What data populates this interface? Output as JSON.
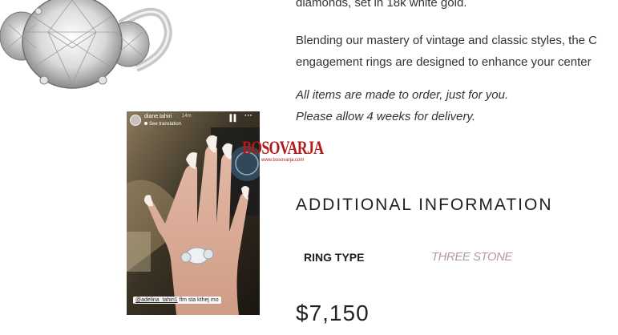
{
  "product": {
    "desc_top": "diamonds, set in 18k white gold.",
    "paragraph_lines": [
      "Blending our mastery of vintage and classic styles, the C",
      "engagement rings are designed to enhance your center"
    ],
    "made_to_order": "All items are made to order, just for you.",
    "delivery_note": "Please allow 4 weeks for delivery.",
    "additional_info_heading": "ADDITIONAL INFORMATION",
    "spec": {
      "label": "RING TYPE",
      "value": "THREE STONE"
    },
    "price": "$7,150"
  },
  "story": {
    "username": "diane.tahiri",
    "time": "14m",
    "translation": "See translation",
    "pause_icon": "pause-icon",
    "more_icon": "more-dots-icon",
    "caption_mention": "@adelina_tahiri1",
    "caption_text": " flm sta kthej mo"
  },
  "watermark": {
    "text": "BOSOVARJA",
    "url": "www.bosovarja.com"
  },
  "colors": {
    "text": "#333333",
    "spec_value": "#b39d97",
    "watermark": "#b01a1a"
  }
}
